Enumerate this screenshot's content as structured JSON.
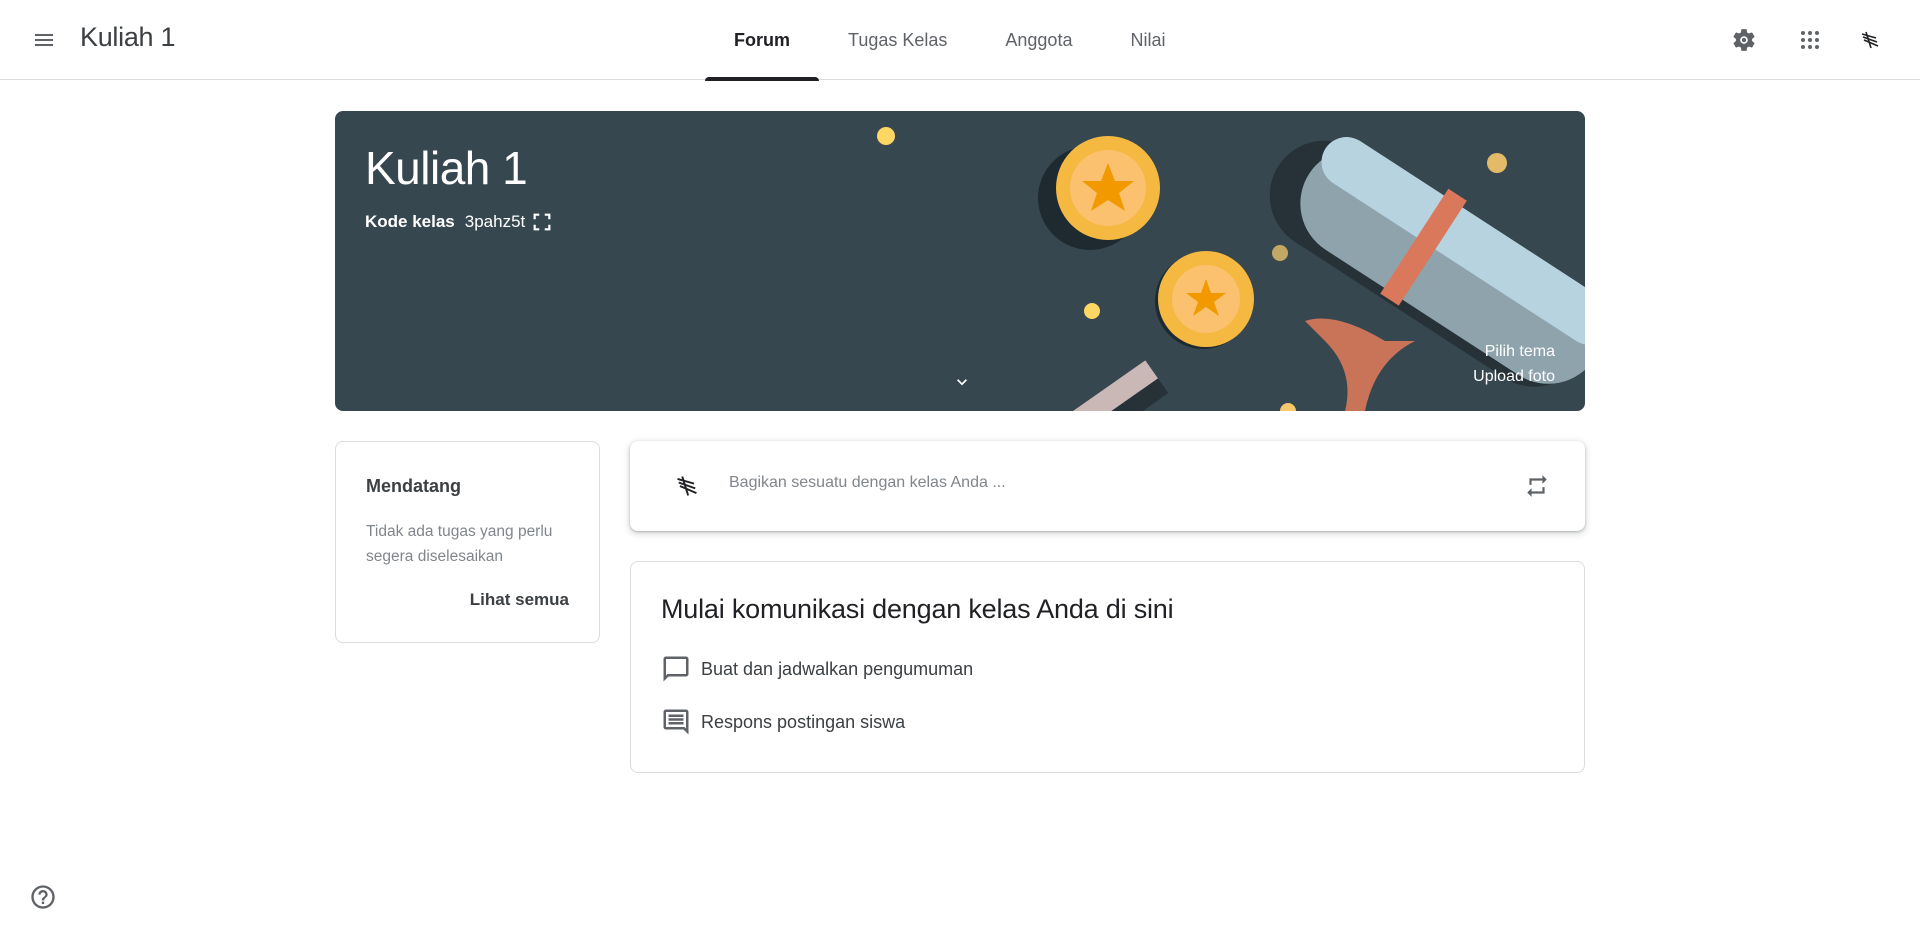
{
  "header": {
    "title": "Kuliah 1",
    "tabs": [
      {
        "label": "Forum",
        "active": true
      },
      {
        "label": "Tugas Kelas",
        "active": false
      },
      {
        "label": "Anggota",
        "active": false
      },
      {
        "label": "Nilai",
        "active": false
      }
    ],
    "icons": [
      "menu-icon",
      "gear-icon",
      "apps-grid-icon",
      "account-avatar-icon"
    ]
  },
  "banner": {
    "title": "Kuliah 1",
    "code_label": "Kode kelas",
    "code_value": "3pahz5t",
    "select_theme": "Pilih tema",
    "upload_photo": "Upload foto",
    "background_color": "#37474f"
  },
  "upcoming": {
    "title": "Mendatang",
    "empty_text": "Tidak ada tugas yang perlu segera diselesaikan",
    "view_all": "Lihat semua"
  },
  "share": {
    "placeholder": "Bagikan sesuatu dengan kelas Anda ..."
  },
  "communicate": {
    "title": "Mulai komunikasi dengan kelas Anda di sini",
    "items": [
      {
        "label": "Buat dan jadwalkan pengumuman",
        "icon": "chat-bubble-icon"
      },
      {
        "label": "Respons postingan siswa",
        "icon": "comment-lines-icon"
      }
    ]
  },
  "colors": {
    "accent": "#202124",
    "border": "#dadce0",
    "muted_text": "#80868b"
  }
}
